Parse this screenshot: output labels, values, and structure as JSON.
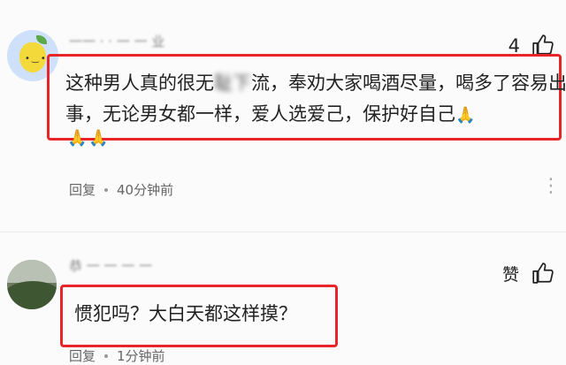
{
  "comments": [
    {
      "username": "一一 · · 一 一 业",
      "like_count": "4",
      "text_before": "这种男人真的很无",
      "text_obscured": "耻下",
      "text_after": "流，奉劝大家喝酒尽量，喝多了容易出事，无论男女都一样，爱人选爱己，保护好自己",
      "emoji_inline": "🙏",
      "emoji_extra": "🙏🙏",
      "reply_label": "回复",
      "time": "40分钟前"
    },
    {
      "username": "恭 一 一 一 一",
      "like_label": "赞",
      "text": "惯犯吗？大白天都这样摸？",
      "reply_label": "回复",
      "time": "1分钟前"
    }
  ],
  "icons": {
    "like": "thumbs-up-icon",
    "more": "more-icon"
  },
  "colors": {
    "highlight_border": "#e8262a",
    "background": "#fbfbfb"
  }
}
